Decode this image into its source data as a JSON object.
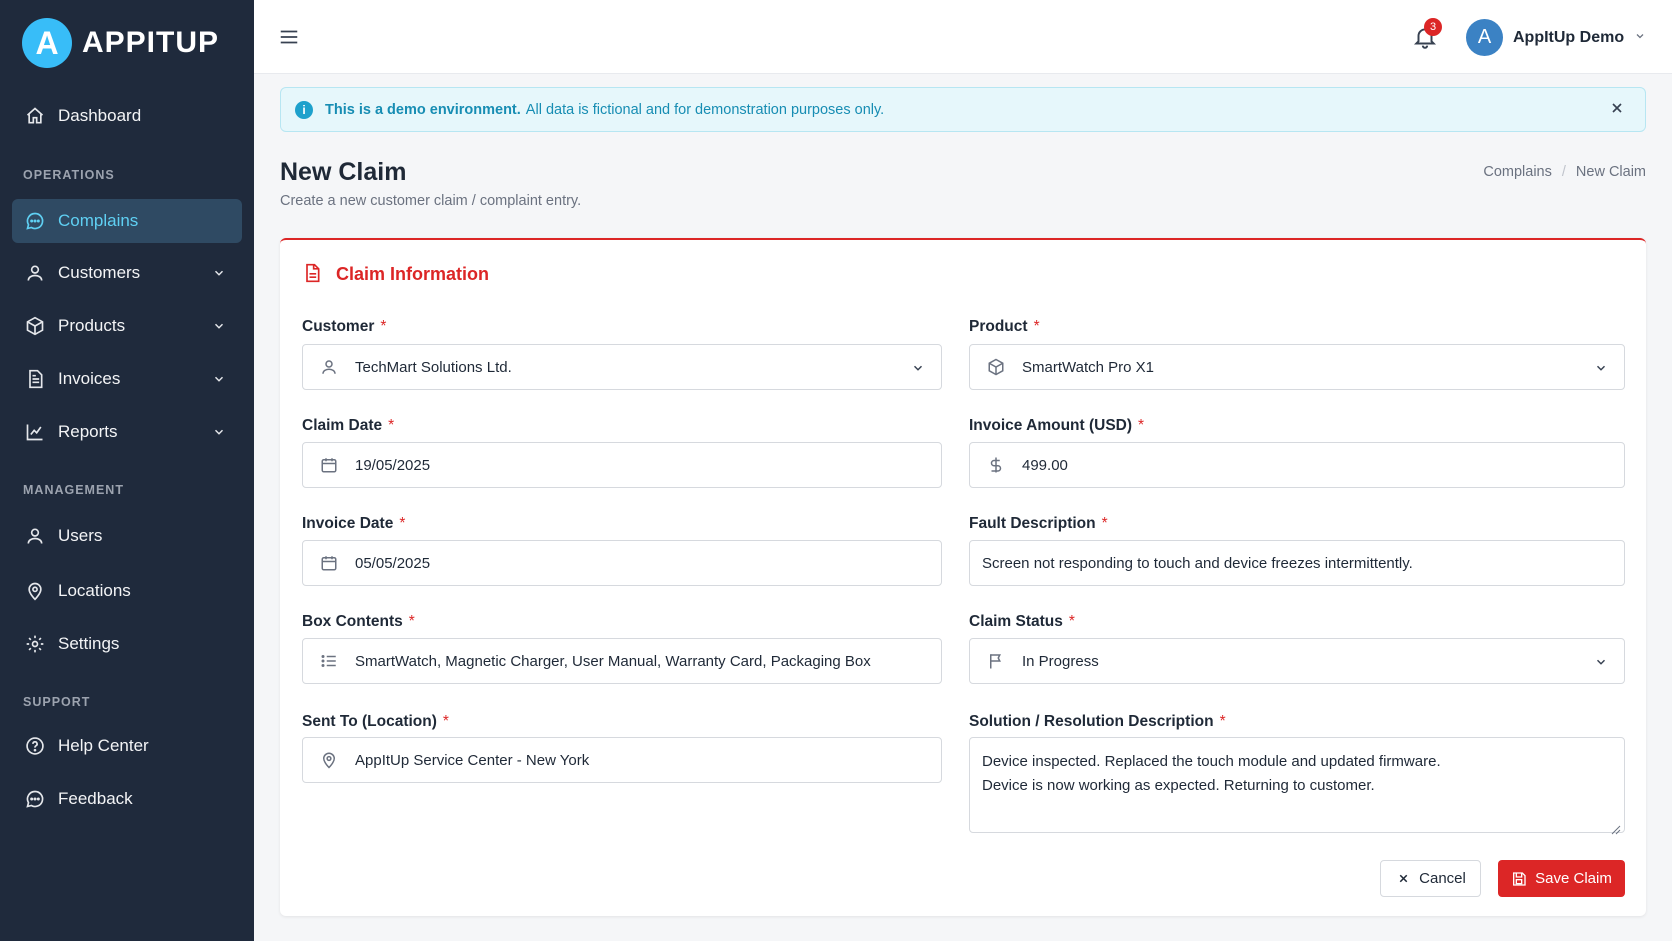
{
  "brand": {
    "logo_letter": "A",
    "name": "APPITUP"
  },
  "sidebar": {
    "dashboard": "Dashboard",
    "sections": {
      "operations": "OPERATIONS",
      "management": "MANAGEMENT",
      "support": "SUPPORT"
    },
    "operations": [
      {
        "label": "Complains",
        "icon": "chat-icon",
        "active": true
      },
      {
        "label": "Customers",
        "icon": "user-icon"
      },
      {
        "label": "Products",
        "icon": "box-icon"
      },
      {
        "label": "Invoices",
        "icon": "document-icon"
      },
      {
        "label": "Reports",
        "icon": "chart-icon"
      }
    ],
    "management": [
      {
        "label": "Users",
        "icon": "user-icon"
      },
      {
        "label": "Locations",
        "icon": "pin-icon"
      },
      {
        "label": "Settings",
        "icon": "gear-icon"
      }
    ],
    "support": [
      {
        "label": "Help Center",
        "icon": "help-icon"
      },
      {
        "label": "Feedback",
        "icon": "chat-icon"
      }
    ]
  },
  "topbar": {
    "notifications_count": "3",
    "user_initial": "A",
    "user_name": "AppItUp Demo"
  },
  "alert": {
    "strong": "This is a demo environment.",
    "text": "All data is fictional and for demonstration purposes only."
  },
  "page": {
    "title": "New Claim",
    "subtitle": "Create a new customer claim / complaint entry.",
    "breadcrumb": {
      "parent": "Complains",
      "separator": "/",
      "current": "New Claim"
    }
  },
  "form": {
    "title": "Claim Information",
    "required_mark": "*",
    "customer": {
      "label": "Customer",
      "value": "TechMart Solutions Ltd."
    },
    "product": {
      "label": "Product",
      "value": "SmartWatch Pro X1"
    },
    "claim_date": {
      "label": "Claim Date",
      "value": "19/05/2025"
    },
    "invoice_amount": {
      "label": "Invoice Amount (USD)",
      "value": "499.00"
    },
    "invoice_date": {
      "label": "Invoice Date",
      "value": "05/05/2025"
    },
    "fault_description": {
      "label": "Fault Description",
      "value": "Screen not responding to touch and device freezes intermittently."
    },
    "box_contents": {
      "label": "Box Contents",
      "value": "SmartWatch, Magnetic Charger, User Manual, Warranty Card, Packaging Box"
    },
    "claim_status": {
      "label": "Claim Status",
      "value": "In Progress"
    },
    "sent_to": {
      "label": "Sent To (Location)",
      "value": "AppItUp Service Center - New York"
    },
    "solution": {
      "label": "Solution / Resolution Description",
      "line1": "Device inspected. Replaced the touch module and updated firmware.",
      "line2": "Device is now working as expected. Returning to customer."
    },
    "cancel_label": "Cancel",
    "save_label": "Save Claim"
  },
  "colors": {
    "sidebar_bg": "#1f2a3c",
    "accent": "#dc2626",
    "active_text": "#5fd0f3",
    "info": "#178db3"
  }
}
